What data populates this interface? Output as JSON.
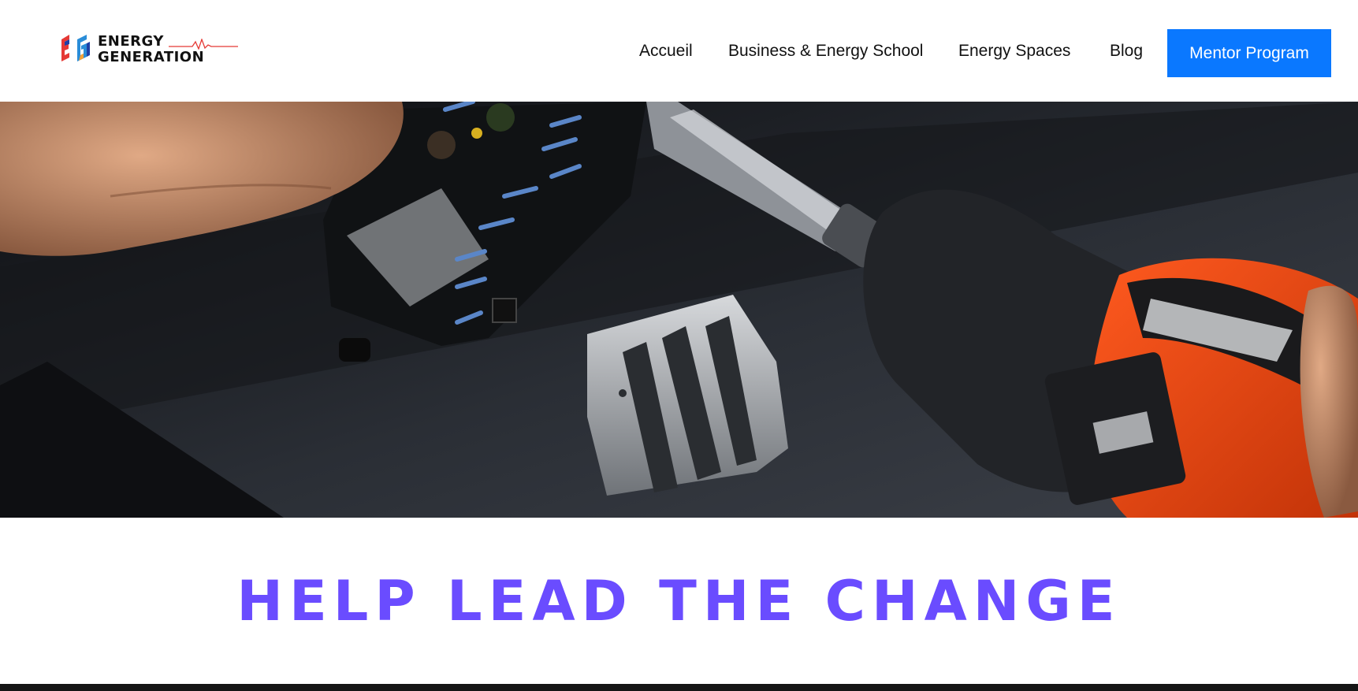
{
  "header": {
    "logo": {
      "line1": "ENERGY",
      "line2": "GENERATION",
      "mark_colors": [
        "#e53935",
        "#1e3fa6",
        "#f2a23a",
        "#2a8dd8"
      ]
    },
    "nav": {
      "items": [
        {
          "label": "Accueil"
        },
        {
          "label": "Business & Energy School"
        },
        {
          "label": "Energy Spaces"
        },
        {
          "label": "Blog"
        }
      ],
      "cta": {
        "label": "Mentor Program",
        "color": "#0a78ff"
      }
    }
  },
  "hero": {
    "image_icon": "drill-circuit-board-photo",
    "slides": {
      "count": 4,
      "active": 1
    }
  },
  "headline": {
    "text": "HELP LEAD THE CHANGE",
    "color": "#6a4cff"
  }
}
